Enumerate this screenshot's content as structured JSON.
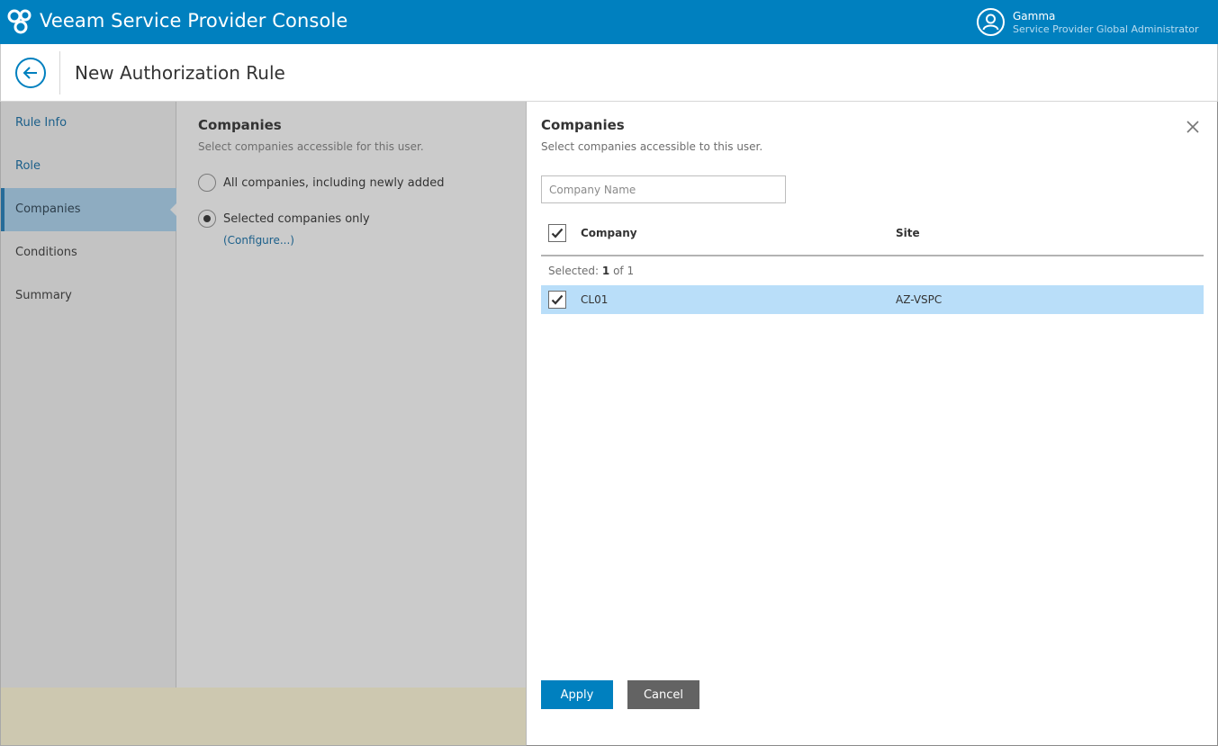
{
  "app": {
    "title": "Veeam Service Provider Console",
    "icon": "veeam-logo-icon",
    "user": {
      "name": "Gamma",
      "role": "Service Provider Global Administrator",
      "icon": "user-avatar-icon"
    }
  },
  "page": {
    "title": "New Authorization Rule",
    "back_icon": "arrow-left-icon"
  },
  "nav": {
    "items": [
      {
        "label": "Rule Info",
        "state": "link"
      },
      {
        "label": "Role",
        "state": "link"
      },
      {
        "label": "Companies",
        "state": "active"
      },
      {
        "label": "Conditions",
        "state": "plain"
      },
      {
        "label": "Summary",
        "state": "plain"
      }
    ]
  },
  "companies_step": {
    "heading": "Companies",
    "subtitle": "Select companies accessible for this user.",
    "options": [
      {
        "label": "All companies, including newly added",
        "selected": false
      },
      {
        "label": "Selected companies only",
        "selected": true
      }
    ],
    "configure_link": "(Configure...)"
  },
  "dialog": {
    "title": "Companies",
    "subtitle": "Select companies accessible to this user.",
    "close_icon": "close-icon",
    "search": {
      "placeholder": "Company Name",
      "value": ""
    },
    "columns": [
      "Company",
      "Site"
    ],
    "selected_label": "Selected:",
    "selected_count": "1",
    "selected_total": "of 1",
    "rows": [
      {
        "company": "CL01",
        "site": "AZ-VSPC",
        "checked": true
      }
    ],
    "apply_label": "Apply",
    "cancel_label": "Cancel"
  },
  "colors": {
    "brand": "#0080bf",
    "selected_row": "#b9def9",
    "nav_active": "#8eacc1"
  }
}
